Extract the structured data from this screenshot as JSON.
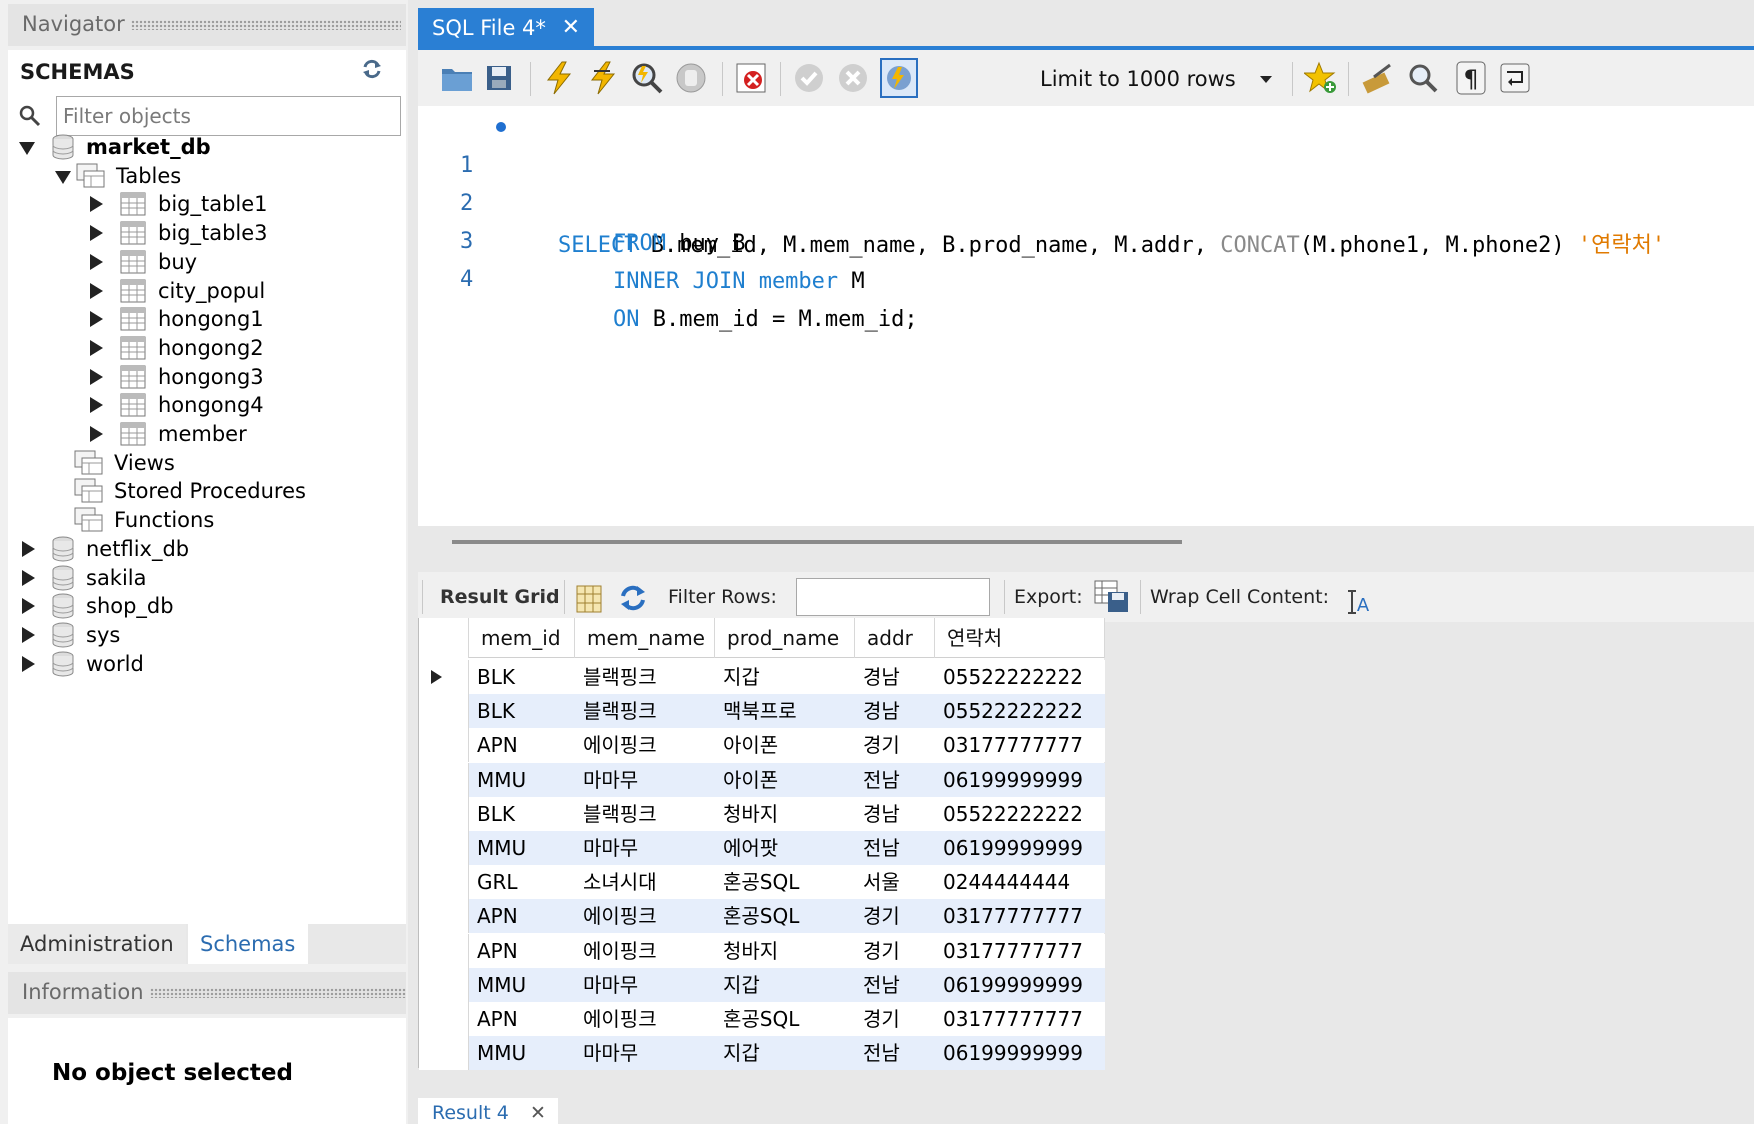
{
  "navigator": {
    "header": "Navigator",
    "schemas_title": "SCHEMAS",
    "filter_placeholder": "Filter objects",
    "tree": [
      {
        "label": "market_db",
        "kind": "db",
        "expanded": true,
        "bold": true
      },
      {
        "label": "Tables",
        "kind": "group",
        "expanded": true
      },
      {
        "label": "big_table1",
        "kind": "table"
      },
      {
        "label": "big_table3",
        "kind": "table"
      },
      {
        "label": "buy",
        "kind": "table"
      },
      {
        "label": "city_popul",
        "kind": "table"
      },
      {
        "label": "hongong1",
        "kind": "table"
      },
      {
        "label": "hongong2",
        "kind": "table"
      },
      {
        "label": "hongong3",
        "kind": "table"
      },
      {
        "label": "hongong4",
        "kind": "table"
      },
      {
        "label": "member",
        "kind": "table"
      },
      {
        "label": "Views",
        "kind": "group-leaf"
      },
      {
        "label": "Stored Procedures",
        "kind": "group-leaf"
      },
      {
        "label": "Functions",
        "kind": "group-leaf"
      },
      {
        "label": "netflix_db",
        "kind": "db"
      },
      {
        "label": "sakila",
        "kind": "db"
      },
      {
        "label": "shop_db",
        "kind": "db"
      },
      {
        "label": "sys",
        "kind": "db"
      },
      {
        "label": "world",
        "kind": "db"
      }
    ],
    "tabs": {
      "administration": "Administration",
      "schemas": "Schemas"
    },
    "info_header": "Information",
    "info_text": "No object selected"
  },
  "editor": {
    "tab_label": "SQL File 4*",
    "tab_close": "✕",
    "limit_label": "Limit to 1000 rows",
    "lines": [
      {
        "num": "1"
      },
      {
        "num": "2"
      },
      {
        "num": "3"
      },
      {
        "num": "4"
      }
    ],
    "code": {
      "l1_kw": "SELECT",
      "l1_a": " B.mem_id, M.mem_name, B.prod_name, M.addr, ",
      "l1_fn": "CONCAT",
      "l1_b": "(M.phone1, M.phone2) ",
      "l1_str": "'연락처'",
      "l2_kw": "FROM",
      "l2_a": " buy B",
      "l3_kw": "INNER JOIN member",
      "l3_a": " M",
      "l4_kw": "ON",
      "l4_a": " B.mem_id = M.mem_id;"
    }
  },
  "result_toolbar": {
    "result_grid": "Result Grid",
    "filter_rows": "Filter Rows:",
    "export": "Export:",
    "wrap": "Wrap Cell Content:"
  },
  "grid": {
    "columns": [
      "mem_id",
      "mem_name",
      "prod_name",
      "addr",
      "연락처"
    ],
    "rows": [
      [
        "BLK",
        "블랙핑크",
        "지갑",
        "경남",
        "05522222222"
      ],
      [
        "BLK",
        "블랙핑크",
        "맥북프로",
        "경남",
        "05522222222"
      ],
      [
        "APN",
        "에이핑크",
        "아이폰",
        "경기",
        "03177777777"
      ],
      [
        "MMU",
        "마마무",
        "아이폰",
        "전남",
        "06199999999"
      ],
      [
        "BLK",
        "블랙핑크",
        "청바지",
        "경남",
        "05522222222"
      ],
      [
        "MMU",
        "마마무",
        "에어팟",
        "전남",
        "06199999999"
      ],
      [
        "GRL",
        "소녀시대",
        "혼공SQL",
        "서울",
        "0244444444"
      ],
      [
        "APN",
        "에이핑크",
        "혼공SQL",
        "경기",
        "03177777777"
      ],
      [
        "APN",
        "에이핑크",
        "청바지",
        "경기",
        "03177777777"
      ],
      [
        "MMU",
        "마마무",
        "지갑",
        "전남",
        "06199999999"
      ],
      [
        "APN",
        "에이핑크",
        "혼공SQL",
        "경기",
        "03177777777"
      ],
      [
        "MMU",
        "마마무",
        "지갑",
        "전남",
        "06199999999"
      ]
    ]
  },
  "result_tab": {
    "label": "Result 4",
    "close": "✕"
  }
}
